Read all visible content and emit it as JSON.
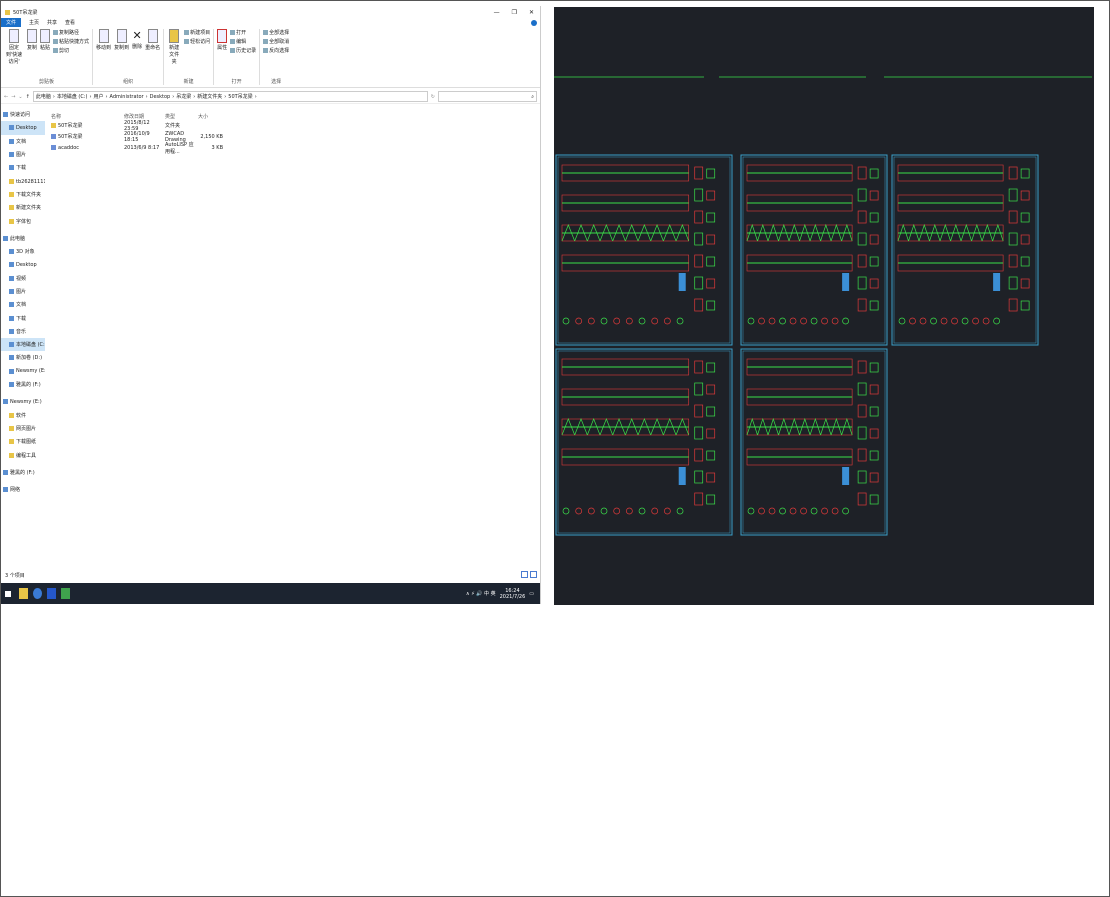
{
  "window": {
    "title": "50T吊龙梁",
    "controls": [
      "—",
      "❐",
      "✕"
    ]
  },
  "menu": {
    "file": "文件",
    "tabs": [
      "主页",
      "共享",
      "查看"
    ]
  },
  "ribbon": {
    "clipboard": {
      "pin": "固定到'快速访问'",
      "copy": "复制",
      "paste": "粘贴",
      "copy_path": "复制路径",
      "paste_shortcut": "粘贴快捷方式",
      "cut": "剪切",
      "name": "剪贴板"
    },
    "organize": {
      "move_to": "移动到",
      "copy_to": "复制到",
      "delete": "删除",
      "rename": "重命名",
      "name": "组织"
    },
    "new": {
      "new_folder": "新建文件夹",
      "new_item": "新建项目",
      "easy_access": "轻松访问",
      "name": "新建"
    },
    "open": {
      "properties": "属性",
      "open": "打开",
      "edit": "编辑",
      "history": "历史记录",
      "name": "打开"
    },
    "select": {
      "select_all": "全部选择",
      "select_none": "全部取消",
      "invert": "反向选择",
      "name": "选择"
    }
  },
  "address": {
    "path": [
      "此电脑",
      "本地磁盘 (C:)",
      "用户",
      "Administrator",
      "Desktop",
      "吊龙梁",
      "新建文件夹",
      "50T吊龙梁"
    ],
    "search_placeholder": ""
  },
  "sidebar": [
    {
      "label": "快速访问",
      "icon": "star-icon",
      "indent": 0
    },
    {
      "label": "Desktop",
      "icon": "desktop-icon",
      "indent": 1,
      "selected": true
    },
    {
      "label": "文档",
      "icon": "doc-icon",
      "indent": 1
    },
    {
      "label": "图片",
      "icon": "picture-icon",
      "indent": 1
    },
    {
      "label": "下载",
      "icon": "download-icon",
      "indent": 1
    },
    {
      "label": "tb2628111130 【图",
      "icon": "folder-icon",
      "indent": 1
    },
    {
      "label": "下载文件夹",
      "icon": "folder-icon",
      "indent": 1
    },
    {
      "label": "新建文件夹",
      "icon": "folder-icon",
      "indent": 1
    },
    {
      "label": "字体包",
      "icon": "folder-icon",
      "indent": 1
    },
    {
      "label": "此电脑",
      "icon": "computer-icon",
      "indent": 0,
      "gap": true
    },
    {
      "label": "3D 对象",
      "icon": "cube-icon",
      "indent": 1
    },
    {
      "label": "Desktop",
      "icon": "desktop-icon",
      "indent": 1
    },
    {
      "label": "视频",
      "icon": "video-icon",
      "indent": 1
    },
    {
      "label": "图片",
      "icon": "picture-icon",
      "indent": 1
    },
    {
      "label": "文档",
      "icon": "doc-icon",
      "indent": 1
    },
    {
      "label": "下载",
      "icon": "download-icon",
      "indent": 1
    },
    {
      "label": "音乐",
      "icon": "music-icon",
      "indent": 1
    },
    {
      "label": "本地磁盘 (C:)",
      "icon": "drive-icon",
      "indent": 1,
      "selected": true
    },
    {
      "label": "新加卷 (D:)",
      "icon": "drive-icon",
      "indent": 1
    },
    {
      "label": "Newsmy (E:)",
      "icon": "drive-icon",
      "indent": 1
    },
    {
      "label": "雅黑的 (F:)",
      "icon": "drive-icon",
      "indent": 1
    },
    {
      "label": "Newsmy (E:)",
      "icon": "drive-icon",
      "indent": 0,
      "gap": true
    },
    {
      "label": "软件",
      "icon": "folder-icon",
      "indent": 1
    },
    {
      "label": "网页图片",
      "icon": "folder-icon",
      "indent": 1
    },
    {
      "label": "下载图纸",
      "icon": "folder-icon",
      "indent": 1
    },
    {
      "label": "编程工具",
      "icon": "folder-icon",
      "indent": 1
    },
    {
      "label": "雅黑的 (F:)",
      "icon": "drive-icon",
      "indent": 0,
      "gap": true
    },
    {
      "label": "网络",
      "icon": "network-icon",
      "indent": 0,
      "gap": true
    }
  ],
  "table": {
    "headers": {
      "name": "名称",
      "date": "修改日期",
      "type": "类型",
      "size": "大小"
    },
    "rows": [
      {
        "name": "50T吊龙梁",
        "date": "2015/8/12 23:59",
        "type": "文件夹",
        "size": "",
        "icon": "folder-icon"
      },
      {
        "name": "50T吊龙梁",
        "date": "2016/10/9 18:15",
        "type": "ZWCAD Drawing",
        "size": "2,150 KB",
        "icon": "dwg-icon"
      },
      {
        "name": "acaddoc",
        "date": "2013/6/9 8:17",
        "type": "AutoLISP 应用程...",
        "size": "3 KB",
        "icon": "lsp-icon"
      }
    ]
  },
  "status": {
    "count": "3 个项目"
  },
  "taskbar": {
    "time": "16:24",
    "date": "2021/7/26",
    "tray": "∧ ⚡ 🔊 中 英"
  },
  "colors": {
    "accent": "#1a6fc9",
    "cad_bg": "#1e2127",
    "cad_frame": "#3aa0c8",
    "cad_green": "#3be04a",
    "cad_red": "#e03a3a"
  }
}
